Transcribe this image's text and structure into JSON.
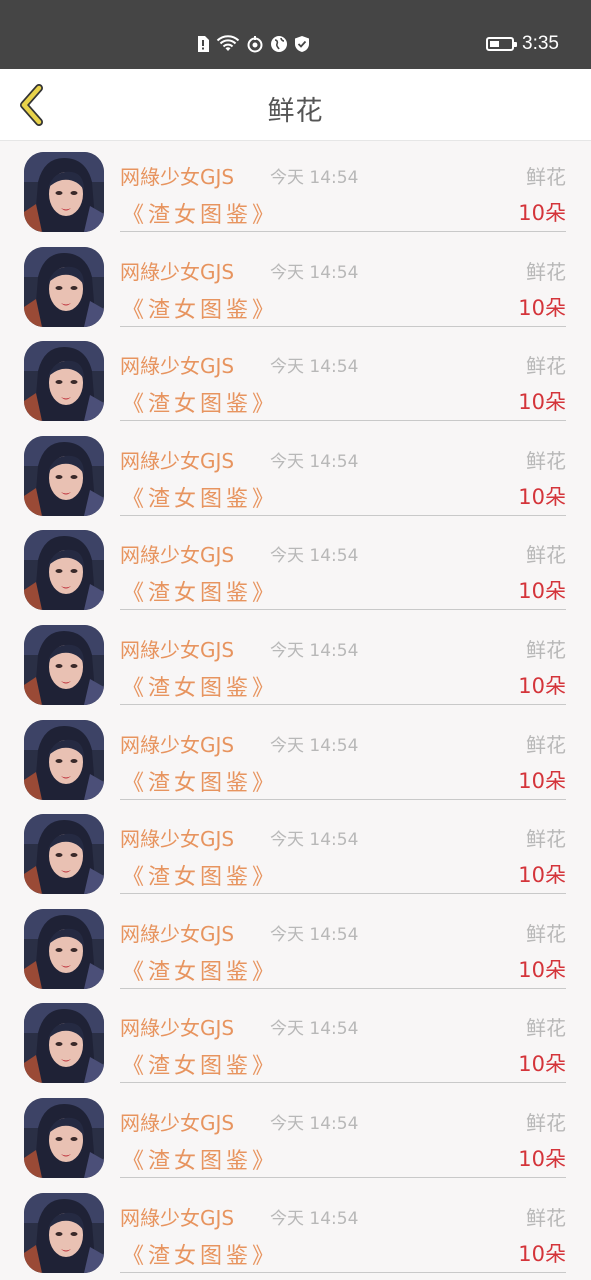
{
  "status_bar": {
    "time": "3:35",
    "battery_level": 0.45,
    "icons": [
      "sim-alert-icon",
      "wifi-icon",
      "data-saver-icon",
      "vpn-globe-icon",
      "shield-check-icon"
    ]
  },
  "header": {
    "title": "鲜花",
    "back_icon": "chevron-left-icon",
    "back_color": "#e8d24a"
  },
  "colors": {
    "username": "#e7945f",
    "count": "#d4343a",
    "muted": "#b8b8b8"
  },
  "records": [
    {
      "user": "网綠少女GJS",
      "time": "今天 14:54",
      "gift": "鲜花",
      "book": "《渣女图鉴》",
      "count": "10朵"
    },
    {
      "user": "网綠少女GJS",
      "time": "今天 14:54",
      "gift": "鲜花",
      "book": "《渣女图鉴》",
      "count": "10朵"
    },
    {
      "user": "网綠少女GJS",
      "time": "今天 14:54",
      "gift": "鲜花",
      "book": "《渣女图鉴》",
      "count": "10朵"
    },
    {
      "user": "网綠少女GJS",
      "time": "今天 14:54",
      "gift": "鲜花",
      "book": "《渣女图鉴》",
      "count": "10朵"
    },
    {
      "user": "网綠少女GJS",
      "time": "今天 14:54",
      "gift": "鲜花",
      "book": "《渣女图鉴》",
      "count": "10朵"
    },
    {
      "user": "网綠少女GJS",
      "time": "今天 14:54",
      "gift": "鲜花",
      "book": "《渣女图鉴》",
      "count": "10朵"
    },
    {
      "user": "网綠少女GJS",
      "time": "今天 14:54",
      "gift": "鲜花",
      "book": "《渣女图鉴》",
      "count": "10朵"
    },
    {
      "user": "网綠少女GJS",
      "time": "今天 14:54",
      "gift": "鲜花",
      "book": "《渣女图鉴》",
      "count": "10朵"
    },
    {
      "user": "网綠少女GJS",
      "time": "今天 14:54",
      "gift": "鲜花",
      "book": "《渣女图鉴》",
      "count": "10朵"
    },
    {
      "user": "网綠少女GJS",
      "time": "今天 14:54",
      "gift": "鲜花",
      "book": "《渣女图鉴》",
      "count": "10朵"
    },
    {
      "user": "网綠少女GJS",
      "time": "今天 14:54",
      "gift": "鲜花",
      "book": "《渣女图鉴》",
      "count": "10朵"
    },
    {
      "user": "网綠少女GJS",
      "time": "今天 14:54",
      "gift": "鲜花",
      "book": "《渣女图鉴》",
      "count": "10朵"
    }
  ]
}
